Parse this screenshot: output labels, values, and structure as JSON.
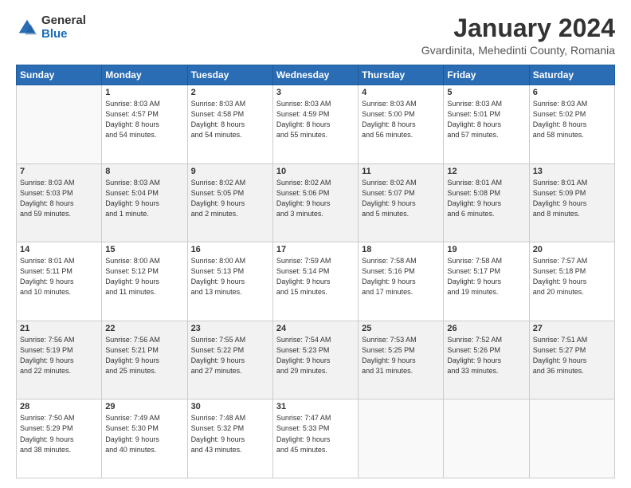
{
  "header": {
    "logo_general": "General",
    "logo_blue": "Blue",
    "title": "January 2024",
    "subtitle": "Gvardinita, Mehedinti County, Romania"
  },
  "days_of_week": [
    "Sunday",
    "Monday",
    "Tuesday",
    "Wednesday",
    "Thursday",
    "Friday",
    "Saturday"
  ],
  "weeks": [
    [
      {
        "num": "",
        "info": ""
      },
      {
        "num": "1",
        "info": "Sunrise: 8:03 AM\nSunset: 4:57 PM\nDaylight: 8 hours\nand 54 minutes."
      },
      {
        "num": "2",
        "info": "Sunrise: 8:03 AM\nSunset: 4:58 PM\nDaylight: 8 hours\nand 54 minutes."
      },
      {
        "num": "3",
        "info": "Sunrise: 8:03 AM\nSunset: 4:59 PM\nDaylight: 8 hours\nand 55 minutes."
      },
      {
        "num": "4",
        "info": "Sunrise: 8:03 AM\nSunset: 5:00 PM\nDaylight: 8 hours\nand 56 minutes."
      },
      {
        "num": "5",
        "info": "Sunrise: 8:03 AM\nSunset: 5:01 PM\nDaylight: 8 hours\nand 57 minutes."
      },
      {
        "num": "6",
        "info": "Sunrise: 8:03 AM\nSunset: 5:02 PM\nDaylight: 8 hours\nand 58 minutes."
      }
    ],
    [
      {
        "num": "7",
        "info": "Sunrise: 8:03 AM\nSunset: 5:03 PM\nDaylight: 8 hours\nand 59 minutes."
      },
      {
        "num": "8",
        "info": "Sunrise: 8:03 AM\nSunset: 5:04 PM\nDaylight: 9 hours\nand 1 minute."
      },
      {
        "num": "9",
        "info": "Sunrise: 8:02 AM\nSunset: 5:05 PM\nDaylight: 9 hours\nand 2 minutes."
      },
      {
        "num": "10",
        "info": "Sunrise: 8:02 AM\nSunset: 5:06 PM\nDaylight: 9 hours\nand 3 minutes."
      },
      {
        "num": "11",
        "info": "Sunrise: 8:02 AM\nSunset: 5:07 PM\nDaylight: 9 hours\nand 5 minutes."
      },
      {
        "num": "12",
        "info": "Sunrise: 8:01 AM\nSunset: 5:08 PM\nDaylight: 9 hours\nand 6 minutes."
      },
      {
        "num": "13",
        "info": "Sunrise: 8:01 AM\nSunset: 5:09 PM\nDaylight: 9 hours\nand 8 minutes."
      }
    ],
    [
      {
        "num": "14",
        "info": "Sunrise: 8:01 AM\nSunset: 5:11 PM\nDaylight: 9 hours\nand 10 minutes."
      },
      {
        "num": "15",
        "info": "Sunrise: 8:00 AM\nSunset: 5:12 PM\nDaylight: 9 hours\nand 11 minutes."
      },
      {
        "num": "16",
        "info": "Sunrise: 8:00 AM\nSunset: 5:13 PM\nDaylight: 9 hours\nand 13 minutes."
      },
      {
        "num": "17",
        "info": "Sunrise: 7:59 AM\nSunset: 5:14 PM\nDaylight: 9 hours\nand 15 minutes."
      },
      {
        "num": "18",
        "info": "Sunrise: 7:58 AM\nSunset: 5:16 PM\nDaylight: 9 hours\nand 17 minutes."
      },
      {
        "num": "19",
        "info": "Sunrise: 7:58 AM\nSunset: 5:17 PM\nDaylight: 9 hours\nand 19 minutes."
      },
      {
        "num": "20",
        "info": "Sunrise: 7:57 AM\nSunset: 5:18 PM\nDaylight: 9 hours\nand 20 minutes."
      }
    ],
    [
      {
        "num": "21",
        "info": "Sunrise: 7:56 AM\nSunset: 5:19 PM\nDaylight: 9 hours\nand 22 minutes."
      },
      {
        "num": "22",
        "info": "Sunrise: 7:56 AM\nSunset: 5:21 PM\nDaylight: 9 hours\nand 25 minutes."
      },
      {
        "num": "23",
        "info": "Sunrise: 7:55 AM\nSunset: 5:22 PM\nDaylight: 9 hours\nand 27 minutes."
      },
      {
        "num": "24",
        "info": "Sunrise: 7:54 AM\nSunset: 5:23 PM\nDaylight: 9 hours\nand 29 minutes."
      },
      {
        "num": "25",
        "info": "Sunrise: 7:53 AM\nSunset: 5:25 PM\nDaylight: 9 hours\nand 31 minutes."
      },
      {
        "num": "26",
        "info": "Sunrise: 7:52 AM\nSunset: 5:26 PM\nDaylight: 9 hours\nand 33 minutes."
      },
      {
        "num": "27",
        "info": "Sunrise: 7:51 AM\nSunset: 5:27 PM\nDaylight: 9 hours\nand 36 minutes."
      }
    ],
    [
      {
        "num": "28",
        "info": "Sunrise: 7:50 AM\nSunset: 5:29 PM\nDaylight: 9 hours\nand 38 minutes."
      },
      {
        "num": "29",
        "info": "Sunrise: 7:49 AM\nSunset: 5:30 PM\nDaylight: 9 hours\nand 40 minutes."
      },
      {
        "num": "30",
        "info": "Sunrise: 7:48 AM\nSunset: 5:32 PM\nDaylight: 9 hours\nand 43 minutes."
      },
      {
        "num": "31",
        "info": "Sunrise: 7:47 AM\nSunset: 5:33 PM\nDaylight: 9 hours\nand 45 minutes."
      },
      {
        "num": "",
        "info": ""
      },
      {
        "num": "",
        "info": ""
      },
      {
        "num": "",
        "info": ""
      }
    ]
  ]
}
